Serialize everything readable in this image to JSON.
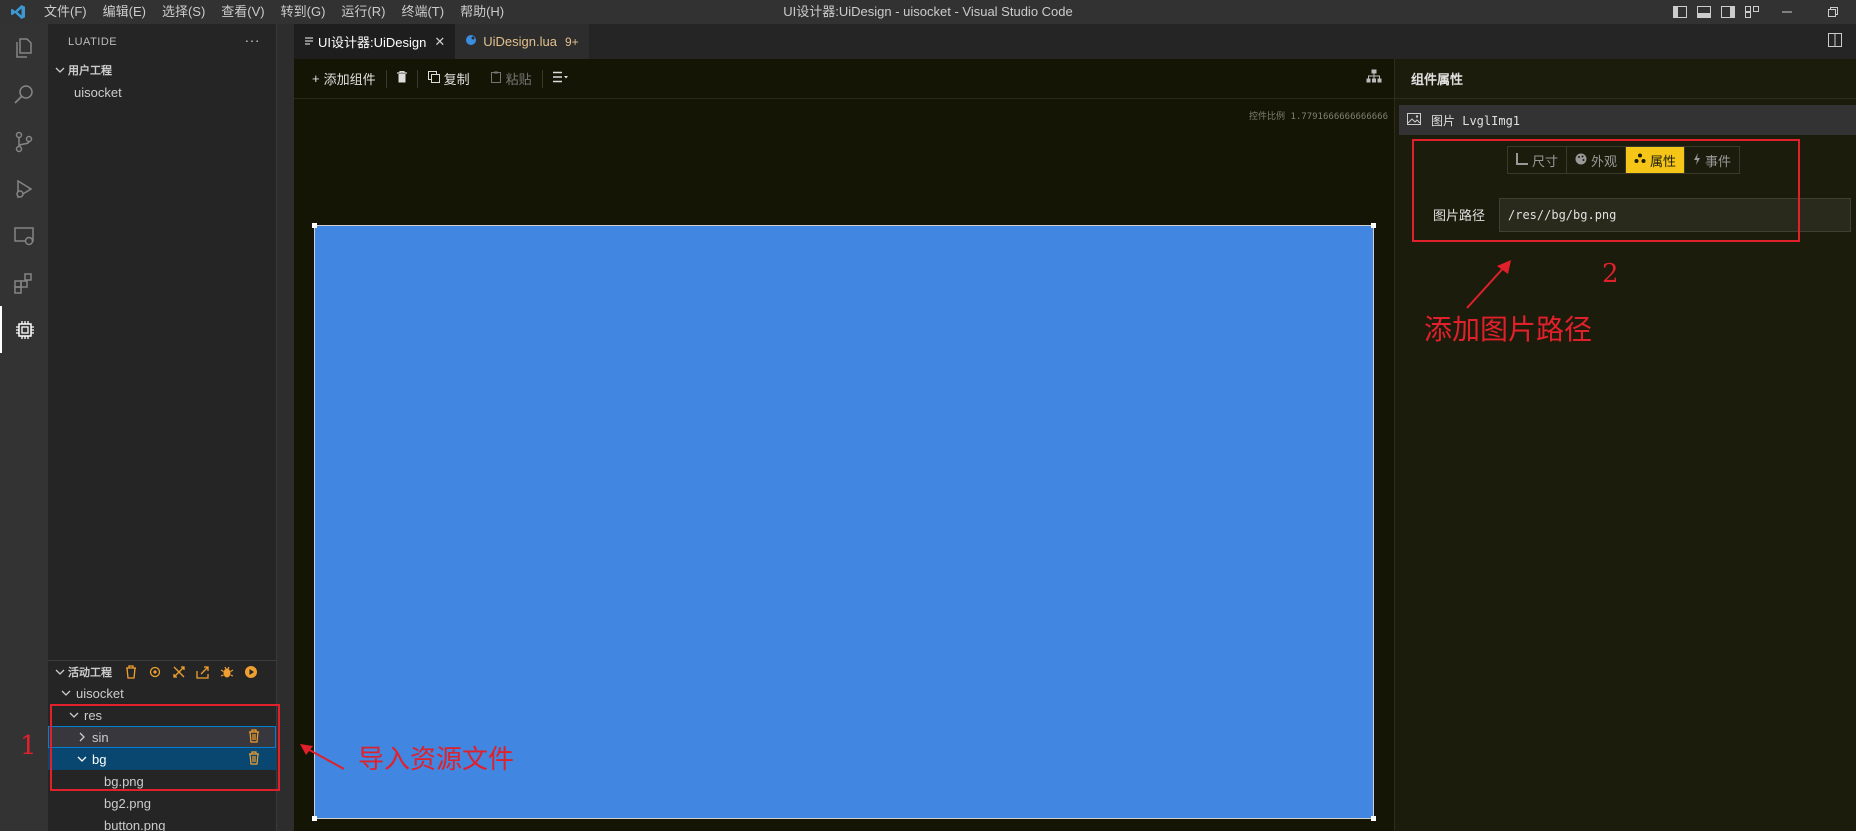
{
  "window": {
    "title": "UI设计器:UiDesign - uisocket - Visual Studio Code",
    "menu": [
      "文件(F)",
      "编辑(E)",
      "选择(S)",
      "查看(V)",
      "转到(G)",
      "运行(R)",
      "终端(T)",
      "帮助(H)"
    ]
  },
  "sidebar": {
    "header": "LUATIDE",
    "more": "···",
    "user_project": {
      "title": "用户工程",
      "items": [
        "uisocket"
      ]
    },
    "active_project": {
      "title": "活动工程",
      "root": "uisocket",
      "folder": "res",
      "subfolders": [
        {
          "label": "sin",
          "expanded": false
        },
        {
          "label": "bg",
          "expanded": true
        }
      ],
      "files": [
        "bg.png",
        "bg2.png",
        "button.png"
      ]
    }
  },
  "tabs": [
    {
      "label": "UI设计器:UiDesign",
      "active": true,
      "close": "✕"
    },
    {
      "label": "UiDesign.lua",
      "badge": "9+",
      "active": false
    }
  ],
  "designer": {
    "toolbar": {
      "add": "添加组件",
      "copy": "复制",
      "paste": "粘贴"
    },
    "ratio_text": "控件比例 1.7791666666666666",
    "canvas_color": "#4186e0"
  },
  "properties": {
    "header": "组件属性",
    "component": "图片 LvglImg1",
    "tabs": [
      "尺寸",
      "外观",
      "属性",
      "事件"
    ],
    "active_tab": "属性",
    "field_label": "图片路径",
    "field_value": "/res//bg/bg.png"
  },
  "annotations": {
    "num1": "1",
    "text1": "导入资源文件",
    "num2": "2",
    "text2": "添加图片路径",
    "color": "#e0202a"
  }
}
